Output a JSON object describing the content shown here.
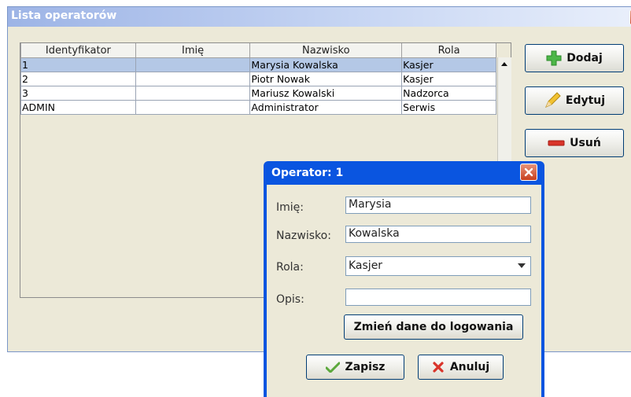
{
  "window": {
    "title": "Lista operatorów"
  },
  "table": {
    "columns": [
      "Identyfikator",
      "Imię",
      "Nazwisko",
      "Rola"
    ],
    "rows": [
      {
        "id": "1",
        "first": "",
        "last": "Marysia Kowalska",
        "role": "Kasjer"
      },
      {
        "id": "2",
        "first": "",
        "last": "Piotr Nowak",
        "role": "Kasjer"
      },
      {
        "id": "3",
        "first": "",
        "last": "Mariusz Kowalski",
        "role": "Nadzorca"
      },
      {
        "id": "ADMIN",
        "first": "",
        "last": "Administrator",
        "role": "Serwis"
      }
    ]
  },
  "actions": {
    "add": "Dodaj",
    "edit": "Edytuj",
    "delete": "Usuń"
  },
  "dialog": {
    "title": "Operator: 1",
    "first_label": "Imię:",
    "first_value": "Marysia",
    "last_label": "Nazwisko:",
    "last_value": "Kowalska",
    "role_label": "Rola:",
    "role_value": "Kasjer",
    "desc_label": "Opis:",
    "desc_value": "",
    "login_button": "Zmień dane do logowania",
    "save_button": "Zapisz",
    "cancel_button": "Anuluj"
  },
  "colors": {
    "titlebar": "#9db4e6",
    "dialog_titlebar": "#0a55e0",
    "selected_row": "#b4c8e6"
  }
}
